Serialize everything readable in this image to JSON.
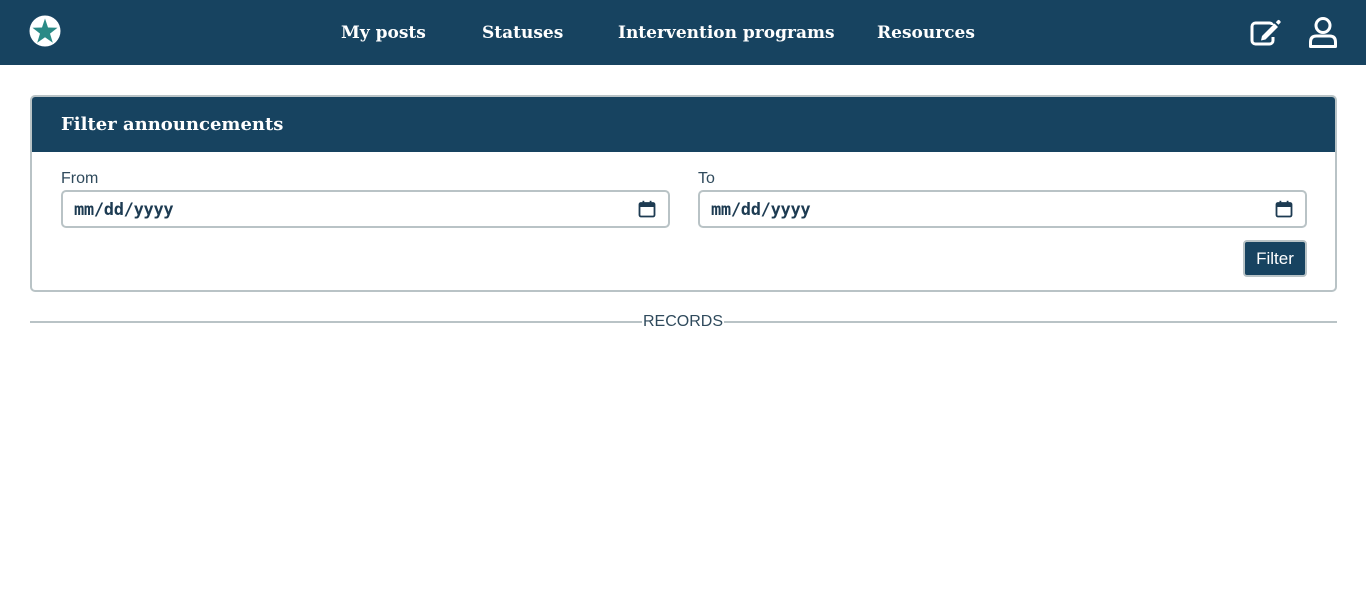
{
  "nav": {
    "logo_icon": "starfish-logo-icon",
    "links": [
      {
        "label": "My posts"
      },
      {
        "label": "Statuses"
      },
      {
        "label": "Intervention programs"
      },
      {
        "label": "Resources"
      }
    ],
    "edit_icon": "edit-icon",
    "profile_icon": "user-icon"
  },
  "filter_card": {
    "title": "Filter announcements",
    "from": {
      "label": "From",
      "placeholder": "mm/dd/yyyy",
      "icon": "calendar-icon"
    },
    "to": {
      "label": "To",
      "placeholder": "mm/dd/yyyy",
      "icon": "calendar-icon"
    },
    "filter_button": "Filter"
  },
  "records": {
    "label": "RECORDS"
  },
  "colors": {
    "primary": "#174360",
    "border": "#b9c3c6",
    "background": "#ffffff",
    "logo_accent": "#2a8a86"
  }
}
